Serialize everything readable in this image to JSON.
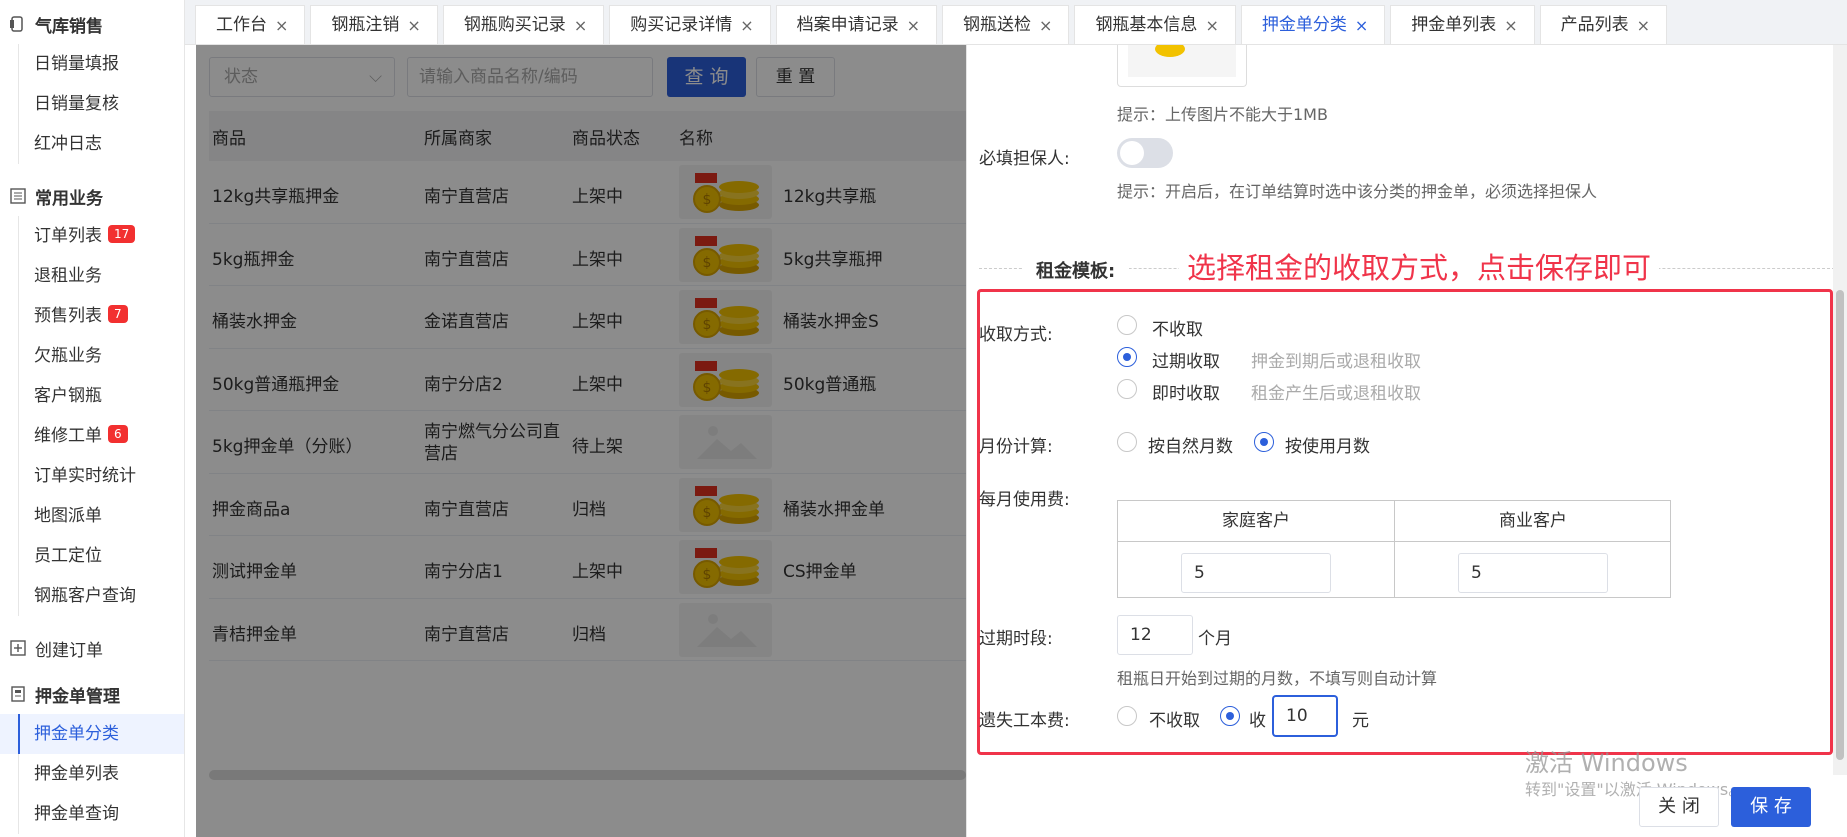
{
  "sidebar": {
    "groups": [
      {
        "label": "气库销售",
        "items": [
          {
            "label": "日销量填报"
          },
          {
            "label": "日销量复核"
          },
          {
            "label": "红冲日志"
          }
        ]
      },
      {
        "label": "常用业务",
        "items": [
          {
            "label": "订单列表",
            "badge": "17"
          },
          {
            "label": "退租业务"
          },
          {
            "label": "预售列表",
            "badge": "7"
          },
          {
            "label": "欠瓶业务"
          },
          {
            "label": "客户钢瓶"
          },
          {
            "label": "维修工单",
            "badge": "6"
          },
          {
            "label": "订单实时统计"
          },
          {
            "label": "地图派单"
          },
          {
            "label": "员工定位"
          },
          {
            "label": "钢瓶客户查询"
          }
        ]
      },
      {
        "label": "创建订单",
        "items": []
      },
      {
        "label": "押金单管理",
        "items": [
          {
            "label": "押金单分类"
          },
          {
            "label": "押金单列表"
          },
          {
            "label": "押金单查询"
          }
        ]
      }
    ]
  },
  "tabs": [
    {
      "label": "工作台"
    },
    {
      "label": "钢瓶注销"
    },
    {
      "label": "钢瓶购买记录"
    },
    {
      "label": "购买记录详情"
    },
    {
      "label": "档案申请记录"
    },
    {
      "label": "钢瓶送检"
    },
    {
      "label": "钢瓶基本信息"
    },
    {
      "label": "押金单分类",
      "active": true
    },
    {
      "label": "押金单列表"
    },
    {
      "label": "产品列表"
    }
  ],
  "filter": {
    "status_placeholder": "状态",
    "search_placeholder": "请输入商品名称/编码",
    "query_label": "查 询",
    "reset_label": "重 置"
  },
  "table": {
    "headers": [
      "商品",
      "所属商家",
      "商品状态",
      "名称"
    ],
    "rows": [
      {
        "product": "12kg共享瓶押金",
        "merchant": "南宁直营店",
        "status": "上架中",
        "name": "12kg共享瓶",
        "image": "coins"
      },
      {
        "product": "5kg瓶押金",
        "merchant": "南宁直营店",
        "status": "上架中",
        "name": "5kg共享瓶押",
        "image": "coins"
      },
      {
        "product": "桶装水押金",
        "merchant": "金诺直营店",
        "status": "上架中",
        "name": "桶装水押金S",
        "image": "coins"
      },
      {
        "product": "50kg普通瓶押金",
        "merchant": "南宁分店2",
        "status": "上架中",
        "name": "50kg普通瓶",
        "image": "coins"
      },
      {
        "product": "5kg押金单（分账）",
        "merchant": "南宁燃气分公司直营店",
        "status": "待上架",
        "name": "",
        "image": "placeholder"
      },
      {
        "product": "押金商品a",
        "merchant": "南宁直营店",
        "status": "归档",
        "name": "桶装水押金单",
        "image": "coins"
      },
      {
        "product": "测试押金单",
        "merchant": "南宁分店1",
        "status": "上架中",
        "name": "CS押金单",
        "image": "coins"
      },
      {
        "product": "青桔押金单",
        "merchant": "南宁直营店",
        "status": "归档",
        "name": "",
        "image": "placeholder"
      }
    ]
  },
  "drawer": {
    "upload_hint": "提示：上传图片不能大于1MB",
    "guarantor_label": "必填担保人:",
    "guarantor_on": false,
    "guarantor_hint": "提示：开启后，在订单结算时选中该分类的押金单，必须选择担保人",
    "section_title": "租金模板:",
    "annotation": "选择租金的收取方式，点击保存即可",
    "collect": {
      "label": "收取方式:",
      "options": [
        {
          "label": "不收取",
          "desc": "",
          "checked": false
        },
        {
          "label": "过期收取",
          "desc": "押金到期后或退租收取",
          "checked": true
        },
        {
          "label": "即时收取",
          "desc": "租金产生后或退租收取",
          "checked": false
        }
      ]
    },
    "month_calc": {
      "label": "月份计算:",
      "options": [
        {
          "label": "按自然月数",
          "checked": false
        },
        {
          "label": "按使用月数",
          "checked": true
        }
      ]
    },
    "monthly_fee": {
      "label": "每月使用费:",
      "columns": [
        "家庭客户",
        "商业客户"
      ],
      "values": [
        "5",
        "5"
      ]
    },
    "expiry": {
      "label": "过期时段:",
      "value": "12",
      "unit": "个月",
      "hint": "租瓶日开始到过期的月数，不填写则自动计算"
    },
    "loss_fee": {
      "label": "遗失工本费:",
      "options": [
        {
          "label": "不收取",
          "checked": false
        },
        {
          "label": "收",
          "checked": true
        }
      ],
      "value": "10",
      "unit": "元"
    },
    "close_label": "关 闭",
    "save_label": "保 存"
  },
  "watermark": {
    "line1": "激活 Windows",
    "line2": "转到\"设置\"以激活 Windows。"
  },
  "colors": {
    "primary": "#2c5fdb",
    "annotation": "#f0344a",
    "badge": "#f23030"
  }
}
